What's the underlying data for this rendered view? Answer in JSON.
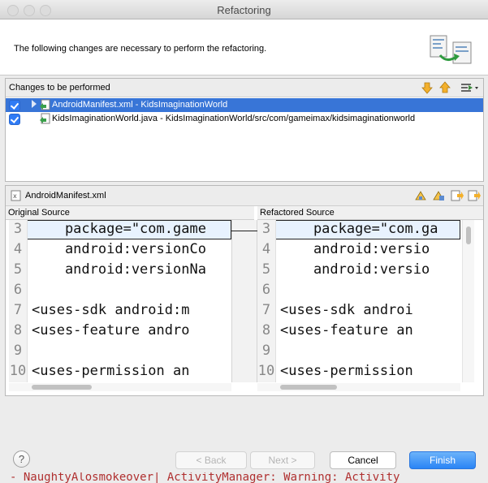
{
  "window": {
    "title": "Refactoring"
  },
  "banner": {
    "message": "The following changes are necessary to perform the refactoring.",
    "icon": "refactoring-wizard-icon"
  },
  "changes": {
    "header": "Changes to be performed",
    "toolbar_icons": [
      "next-change-icon",
      "previous-change-icon",
      "filter-changes-icon"
    ],
    "items": [
      {
        "label": "AndroidManifest.xml - KidsImaginationWorld",
        "checked": true,
        "selected": true,
        "icon": "xml-change-icon"
      },
      {
        "label": "KidsImaginationWorld.java - KidsImaginationWorld/src/com/gameimax/kidsimaginationworld",
        "checked": true,
        "selected": false,
        "icon": "java-change-icon"
      }
    ]
  },
  "compare": {
    "file": "AndroidManifest.xml",
    "toolbar_icons": [
      "copy-all-left-icon",
      "copy-current-left-icon",
      "next-difference-icon",
      "previous-difference-icon"
    ],
    "original": {
      "header": "Original Source",
      "lines": [
        {
          "num": "3",
          "text": "    package=\"com.game"
        },
        {
          "num": "4",
          "text": "    android:versionCo"
        },
        {
          "num": "5",
          "text": "    android:versionNa"
        },
        {
          "num": "6",
          "text": ""
        },
        {
          "num": "7",
          "text": "<uses-sdk android:m"
        },
        {
          "num": "8",
          "text": "<uses-feature andro"
        },
        {
          "num": "9",
          "text": ""
        },
        {
          "num": "10",
          "text": "<uses-permission an"
        }
      ]
    },
    "refactored": {
      "header": "Refactored Source",
      "lines": [
        {
          "num": "3",
          "text": "    package=\"com.ga"
        },
        {
          "num": "4",
          "text": "    android:versio"
        },
        {
          "num": "5",
          "text": "    android:versio"
        },
        {
          "num": "6",
          "text": ""
        },
        {
          "num": "7",
          "text": "<uses-sdk androi"
        },
        {
          "num": "8",
          "text": "<uses-feature an"
        },
        {
          "num": "9",
          "text": ""
        },
        {
          "num": "10",
          "text": "<uses-permission"
        }
      ]
    }
  },
  "buttons": {
    "help": "?",
    "back": "< Back",
    "next": "Next >",
    "cancel": "Cancel",
    "finish": "Finish"
  },
  "background_text": "- NaughtyAlosmokeover| ActivityManager: Warning: Activity"
}
